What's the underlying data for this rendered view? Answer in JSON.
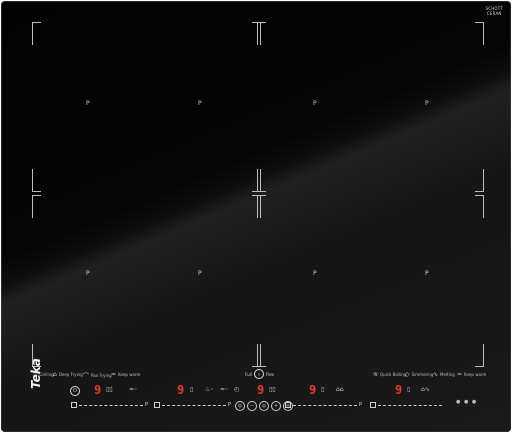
{
  "brand_badge": {
    "line1": "SCHOTT",
    "line2": "CERAN"
  },
  "zone_mark": "P",
  "full_flex": {
    "label_left": "Full",
    "icon": "flex-zone-icon",
    "ring_text": "||",
    "label_right": "Flex"
  },
  "functions_left": [
    {
      "icon": "grill-icon",
      "glyph": "♨",
      "label": "Grilling"
    },
    {
      "icon": "deep-fry-icon",
      "glyph": "⌂",
      "label": "Deep Frying"
    },
    {
      "icon": "pan-fry-icon",
      "glyph": "⌒",
      "label": "Pan Frying"
    },
    {
      "icon": "keep-warm-icon",
      "glyph": "≈",
      "label": "Keep warm"
    }
  ],
  "functions_right": [
    {
      "icon": "quick-boil-icon",
      "glyph": "≋",
      "label": "Quick Boiling"
    },
    {
      "icon": "simmer-icon",
      "glyph": "◇",
      "label": "Simmering"
    },
    {
      "icon": "melt-icon",
      "glyph": "∿",
      "label": "Melting"
    },
    {
      "icon": "keep-warm-icon",
      "glyph": "≈",
      "label": "Keep warm"
    }
  ],
  "controls": {
    "power_glyph": "⏻",
    "zone_displays": [
      "9",
      "9",
      "9",
      "9",
      "9"
    ],
    "slider_max_label": "P",
    "logo": "Teka",
    "timer_buttons": [
      "◎",
      "−",
      "◎",
      "+",
      "◎"
    ]
  },
  "accent_color": "#e63b2e"
}
